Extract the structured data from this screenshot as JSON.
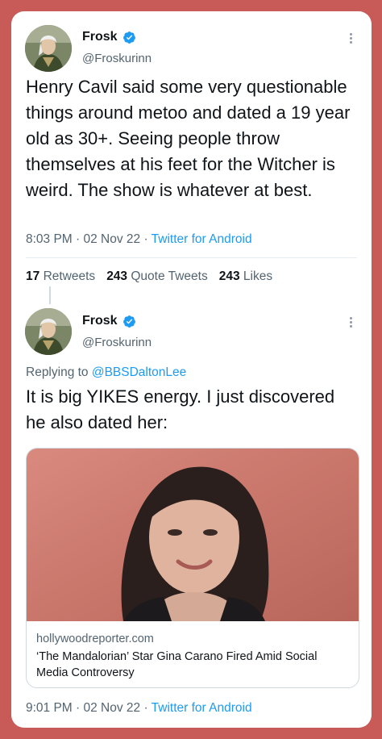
{
  "tweet1": {
    "name": "Frosk",
    "handle": "@Froskurinn",
    "text": "Henry Cavil said some very questionable things around metoo and dated a 19 year old as 30+. Seeing people throw themselves at his feet for the Witcher is weird. The show is whatever at best.",
    "time": "8:03 PM · 02 Nov 22 · ",
    "source": "Twitter for Android",
    "stats": {
      "retweets_count": "17",
      "retweets_label": "Retweets",
      "quotes_count": "243",
      "quotes_label": "Quote Tweets",
      "likes_count": "243",
      "likes_label": "Likes"
    }
  },
  "tweet2": {
    "name": "Frosk",
    "handle": "@Froskurinn",
    "replying_prefix": "Replying to ",
    "replying_to": "@BBSDaltonLee",
    "text": "It is big YIKES energy. I just discovered he also dated her:",
    "link_card": {
      "domain": "hollywoodreporter.com",
      "title": "‘The Mandalorian’ Star Gina Carano Fired Amid Social Media Controversy"
    },
    "time": "9:01 PM · 02 Nov 22 · ",
    "source": "Twitter for Android"
  },
  "colors": {
    "background": "#c85a58",
    "link": "#1d9bf0",
    "muted": "#536471",
    "verified": "#1d9bf0"
  },
  "icons": [
    "verified-badge-icon",
    "more-options-icon"
  ]
}
